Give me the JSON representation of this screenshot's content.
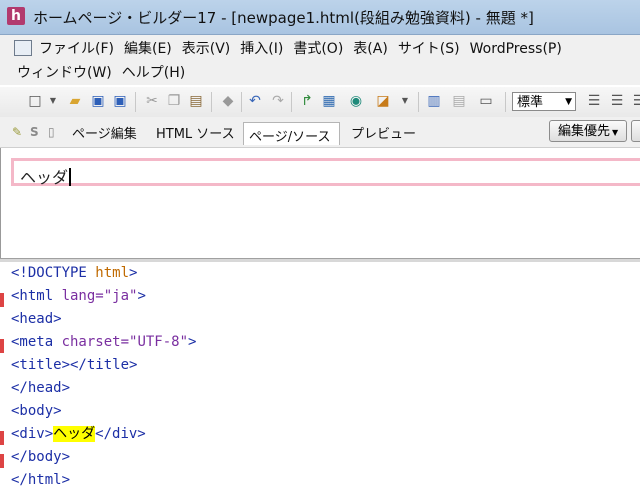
{
  "title_bar": {
    "app_icon_letter": "h",
    "title": "ホームページ・ビルダー17 - [newpage1.html(段組み勉強資料) - 無題 *]"
  },
  "menu": {
    "row1": [
      "ファイル(F)",
      "編集(E)",
      "表示(V)",
      "挿入(I)",
      "書式(O)",
      "表(A)",
      "サイト(S)",
      "WordPress(P)"
    ],
    "row2": [
      "ウィンドウ(W)",
      "ヘルプ(H)"
    ]
  },
  "toolbar": {
    "style_select": "標準",
    "icons": [
      "new-icon",
      "open-icon",
      "save-icon",
      "save-all-icon",
      "cut-icon",
      "copy-icon",
      "paste-icon",
      "eraser-icon",
      "undo-icon",
      "redo-icon",
      "link-icon",
      "image-icon",
      "insert-icon",
      "align-left-icon",
      "align-center-icon"
    ]
  },
  "mode_tabs": {
    "page_edit": "ページ編集",
    "html_source": "HTML ソース",
    "page_source": "ページ/ソース",
    "preview": "プレビュー",
    "edit_priority": "編集優先"
  },
  "design": {
    "header_text": "ヘッダ"
  },
  "source": {
    "l1_open": "<!DOCTYPE ",
    "l1_kw": "html",
    "l1_close": ">",
    "l2_open": "<html ",
    "l2_attr": "lang=",
    "l2_val": "\"ja\"",
    "l2_close": ">",
    "l3": "<head>",
    "l4_open": "<meta ",
    "l4_attr": "charset=",
    "l4_val": "\"UTF-8\"",
    "l4_close": ">",
    "l5": "<title></title>",
    "l6": "</head>",
    "l7": "<body>",
    "l8_open": "<div>",
    "l8_text": "ヘッダ",
    "l8_close": "</div>",
    "l9": "</body>",
    "l10": "</html>"
  }
}
